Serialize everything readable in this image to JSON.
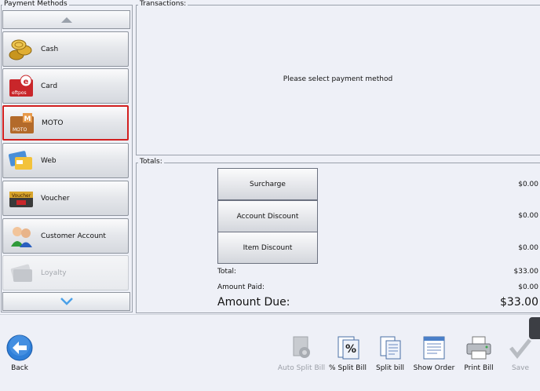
{
  "payment_methods": {
    "title": "Payment Methods",
    "items": [
      {
        "label": "Cash",
        "icon": "cash-coins-icon"
      },
      {
        "label": "Card",
        "icon": "eftpos-card-icon",
        "icon_text": "eftpos"
      },
      {
        "label": "MOTO",
        "icon": "moto-icon",
        "icon_text": "MOTO",
        "selected": true
      },
      {
        "label": "Web",
        "icon": "web-payment-icon"
      },
      {
        "label": "Voucher",
        "icon": "voucher-icon",
        "icon_text": "Voucher"
      },
      {
        "label": "Customer Account",
        "icon": "customer-account-icon"
      },
      {
        "label": "Loyalty",
        "icon": "loyalty-card-icon",
        "disabled": true
      }
    ]
  },
  "transactions": {
    "title": "Transactions:",
    "message": "Please select payment method"
  },
  "totals": {
    "title": "Totals:",
    "buttons": [
      {
        "label": "Surcharge",
        "value": "$0.00"
      },
      {
        "label": "Account Discount",
        "value": "$0.00"
      },
      {
        "label": "Item Discount",
        "value": "$0.00"
      }
    ],
    "total_label": "Total:",
    "total_value": "$33.00",
    "paid_label": "Amount Paid:",
    "paid_value": "$0.00",
    "due_label": "Amount Due:",
    "due_value": "$33.00"
  },
  "bottom_bar": {
    "back": "Back",
    "auto_split": "Auto Split Bill",
    "percent_split": "% Split Bill",
    "split": "Split bill",
    "show_order": "Show Order",
    "print": "Print Bill",
    "save": "Save"
  },
  "colors": {
    "selected_border": "#d21f1f",
    "back_button": "#2f7fd8"
  }
}
